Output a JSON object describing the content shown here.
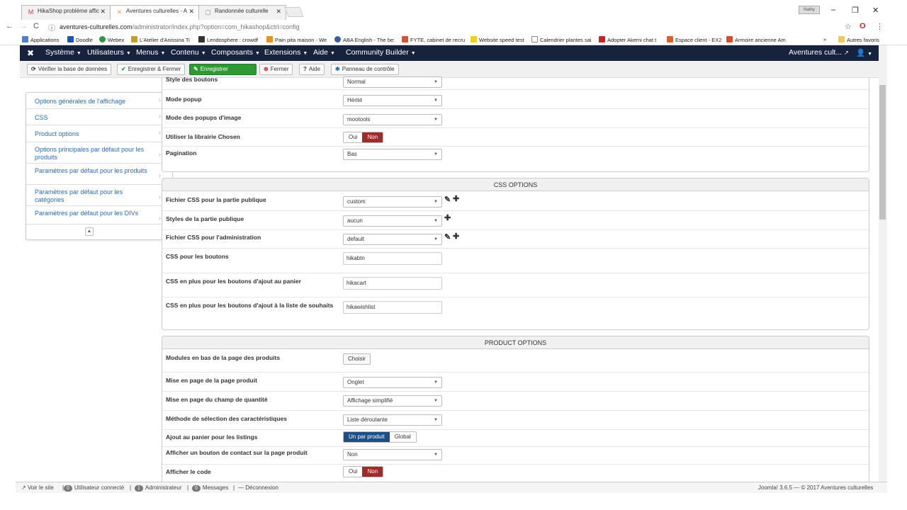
{
  "browser": {
    "tabs": [
      {
        "label": "HikaShop problème affic",
        "icon": "M"
      },
      {
        "label": "Aventures culturelles - A",
        "icon": "✕"
      },
      {
        "label": "Randonnée culturelle",
        "icon": "▢"
      }
    ],
    "user_badge": "Nathy",
    "url_host": "aventures-culturelles.com",
    "url_path": "/administrator/index.php?option=com_hikashop&ctrl=config",
    "bookmarks": [
      "Applications",
      "Doodle",
      "Webex",
      "L'Atelier d'Anissina Ti",
      "Lendosphere : crowdf",
      "Pain pita maison - We",
      "ABA English - The be:",
      "FYTE, cabinet de recru",
      "Website speed test",
      "Calendrier plantes sai",
      "Adopter Akemi chat t",
      "Espace client - EX2",
      "Armoire ancienne Am",
      "»",
      "Autres favoris"
    ]
  },
  "joomla_nav": {
    "items": [
      "Système",
      "Utilisateurs",
      "Menus",
      "Contenu",
      "Composants",
      "Extensions",
      "Aide",
      "Community Builder"
    ],
    "site_link": "Aventures cult..."
  },
  "toolbar": {
    "check_db": "Vérifier la base de données",
    "save_close": "Enregistrer & Fermer",
    "save": "Enregistrer",
    "close": "Fermer",
    "help": "Aide",
    "control_panel": "Panneau de contrôle"
  },
  "sidebar": {
    "items": [
      "Options générales de l'affichage",
      "CSS",
      "Product options",
      "Options principales par défaut pour les produits",
      "Paramètres par défaut pour les produits",
      "Paramètres par défaut pour les catégories",
      "Paramètres par défaut pour les DIVs"
    ]
  },
  "top_section": {
    "rows": [
      {
        "label": "Style des boutons",
        "value": "Normal"
      },
      {
        "label": "Mode popup",
        "value": "Hérité"
      },
      {
        "label": "Mode des popups d'image",
        "value": "mootools"
      },
      {
        "label": "Utiliser la librairie Chosen",
        "yes": "Oui",
        "no": "Non"
      },
      {
        "label": "Pagination",
        "value": "Bas"
      }
    ]
  },
  "css_section": {
    "title": "CSS OPTIONS",
    "rows": [
      {
        "label": "Fichier CSS pour la partie publique",
        "value": "custom"
      },
      {
        "label": "Styles de la partie publique",
        "value": "aucun"
      },
      {
        "label": "Fichier CSS pour l'administration",
        "value": "default"
      },
      {
        "label": "CSS pour les boutons",
        "value": "hikabtn"
      },
      {
        "label": "CSS en plus pour les boutons d'ajout au panier",
        "value": "hikacart"
      },
      {
        "label": "CSS en plus pour les boutons d'ajout à la liste de souhaits",
        "value": "hikawishlist"
      }
    ]
  },
  "product_section": {
    "title": "PRODUCT OPTIONS",
    "rows": [
      {
        "label": "Modules en bas de la page des produits",
        "value": "Choisir"
      },
      {
        "label": "Mise en page de la page produit",
        "value": "Onglet"
      },
      {
        "label": "Mise en page du champ de quantité",
        "value": "Affichage simplifié"
      },
      {
        "label": "Méthode de sélection des caractéristiques",
        "value": "Liste déroulante"
      },
      {
        "label": "Ajout au panier pour les listings",
        "opt1": "Un par produit",
        "opt2": "Global"
      },
      {
        "label": "Afficher un bouton de contact sur la page produit",
        "value": "Non"
      },
      {
        "label": "Afficher le code",
        "yes": "Oui",
        "no": "Non"
      }
    ]
  },
  "statusbar": {
    "view_site": "Voir le site",
    "users_count": "0",
    "users_label": "Utilisateur connecté",
    "admin_count": "1",
    "admin_label": "Administrateur",
    "msg_count": "0",
    "msg_label": "Messages",
    "logout": "Déconnexion",
    "footer": "Joomla! 3.6.5 — © 2017 Aventures culturelles"
  }
}
